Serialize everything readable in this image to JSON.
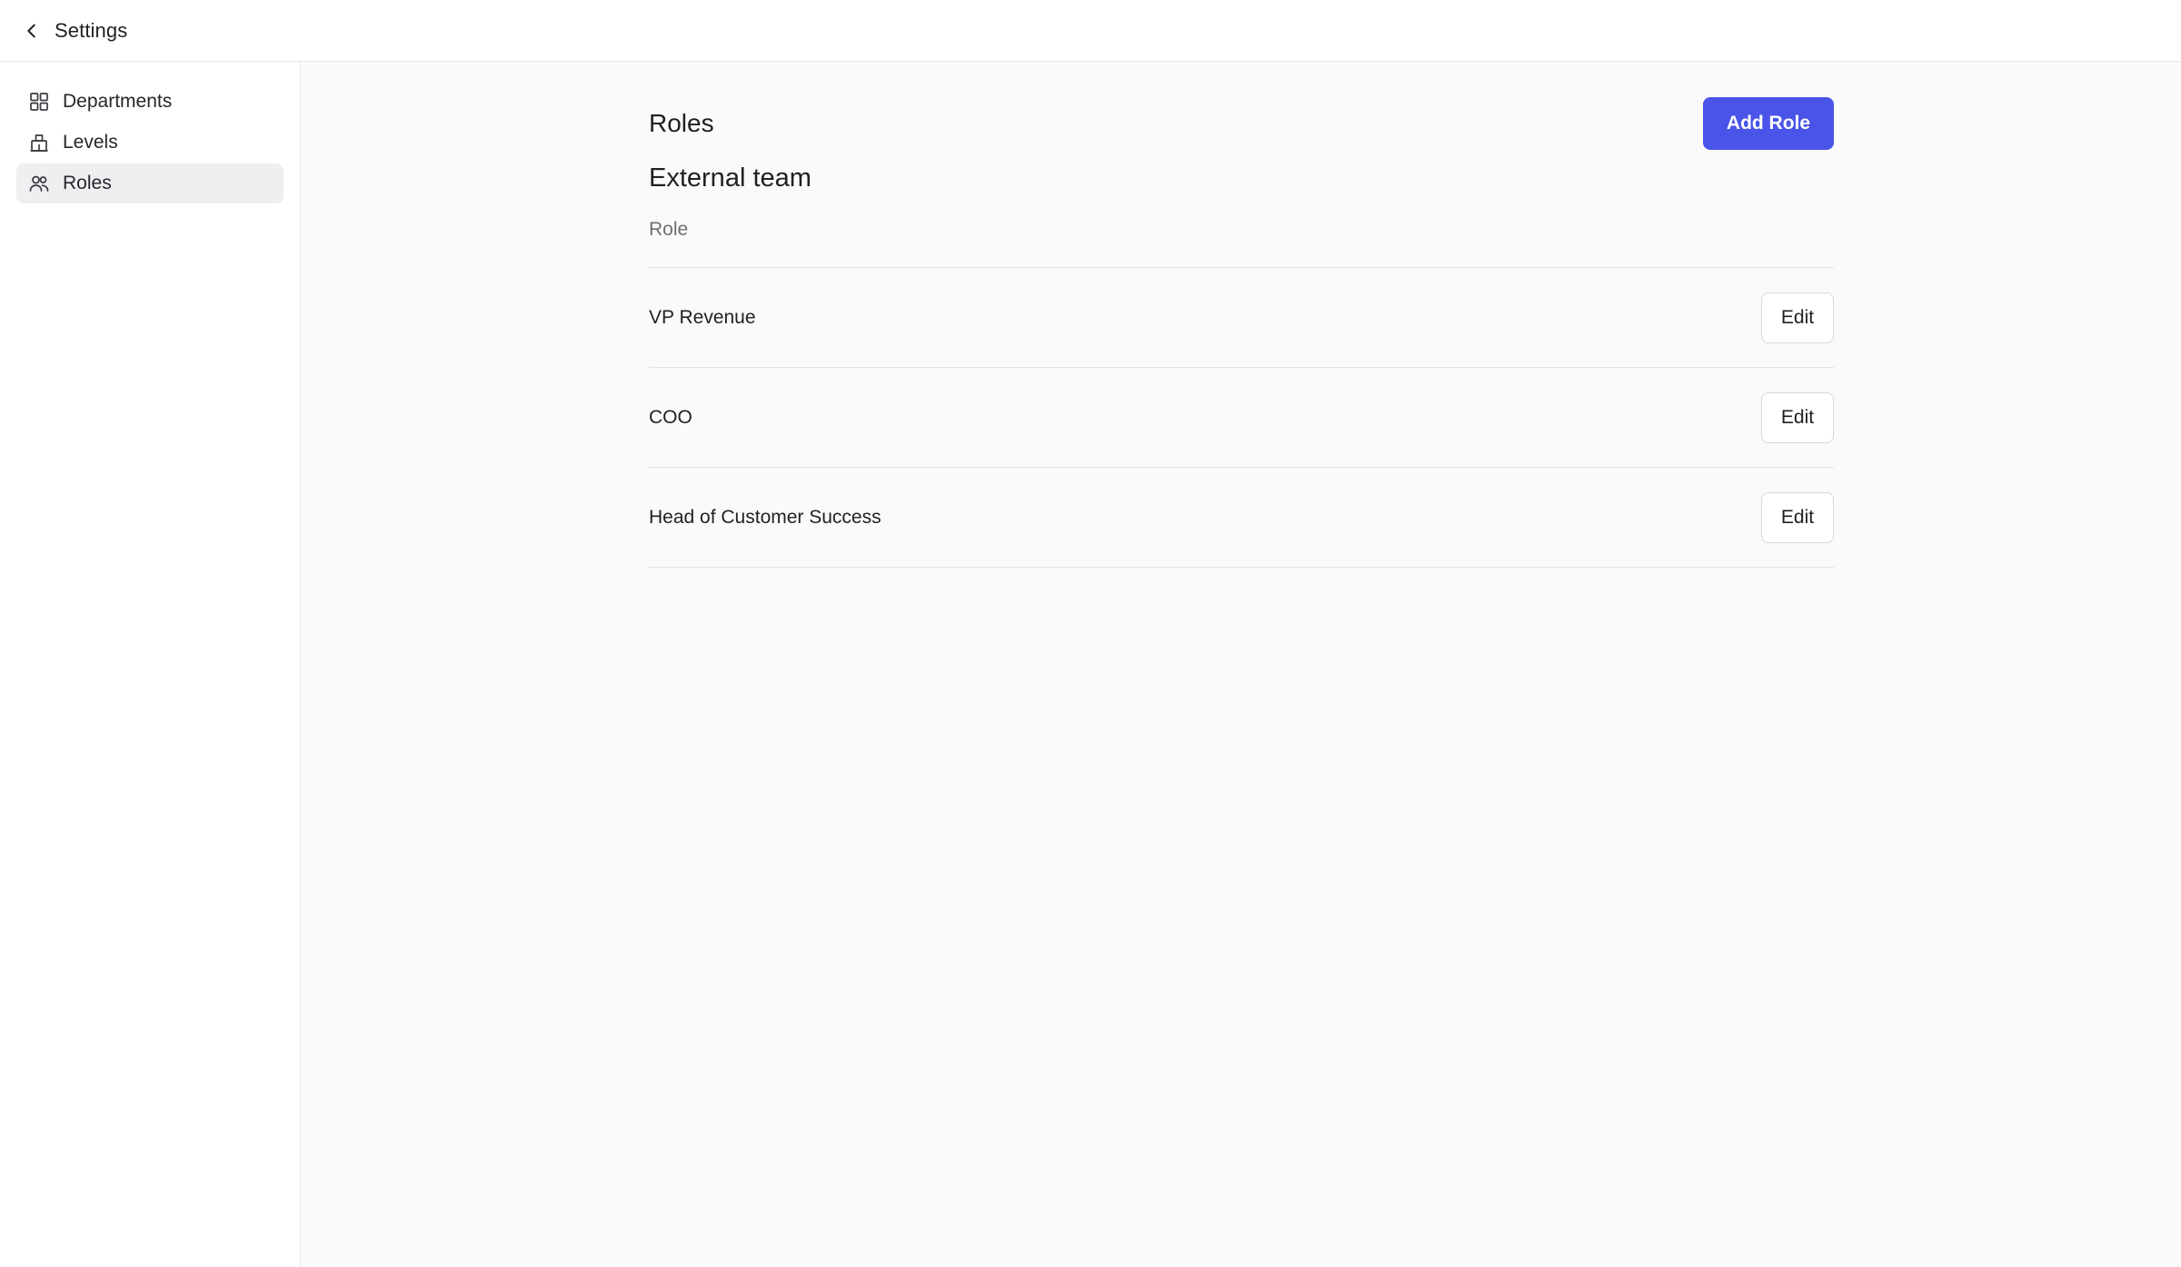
{
  "topbar": {
    "back_icon": "chevron-left-icon",
    "title": "Settings"
  },
  "sidebar": {
    "items": [
      {
        "label": "Departments",
        "icon": "grid-icon",
        "active": false
      },
      {
        "label": "Levels",
        "icon": "building-icon",
        "active": false
      },
      {
        "label": "Roles",
        "icon": "users-icon",
        "active": true
      }
    ]
  },
  "main": {
    "title": "Roles",
    "add_button_label": "Add Role",
    "section_title": "External team",
    "column_header": "Role",
    "rows": [
      {
        "name": "VP Revenue",
        "edit_label": "Edit"
      },
      {
        "name": "COO",
        "edit_label": "Edit"
      },
      {
        "name": "Head of Customer Success",
        "edit_label": "Edit"
      }
    ]
  },
  "colors": {
    "accent": "#4a54e8",
    "active_nav_bg": "#efeff1",
    "divider": "#e2e2e5",
    "main_bg": "#fafafa"
  }
}
